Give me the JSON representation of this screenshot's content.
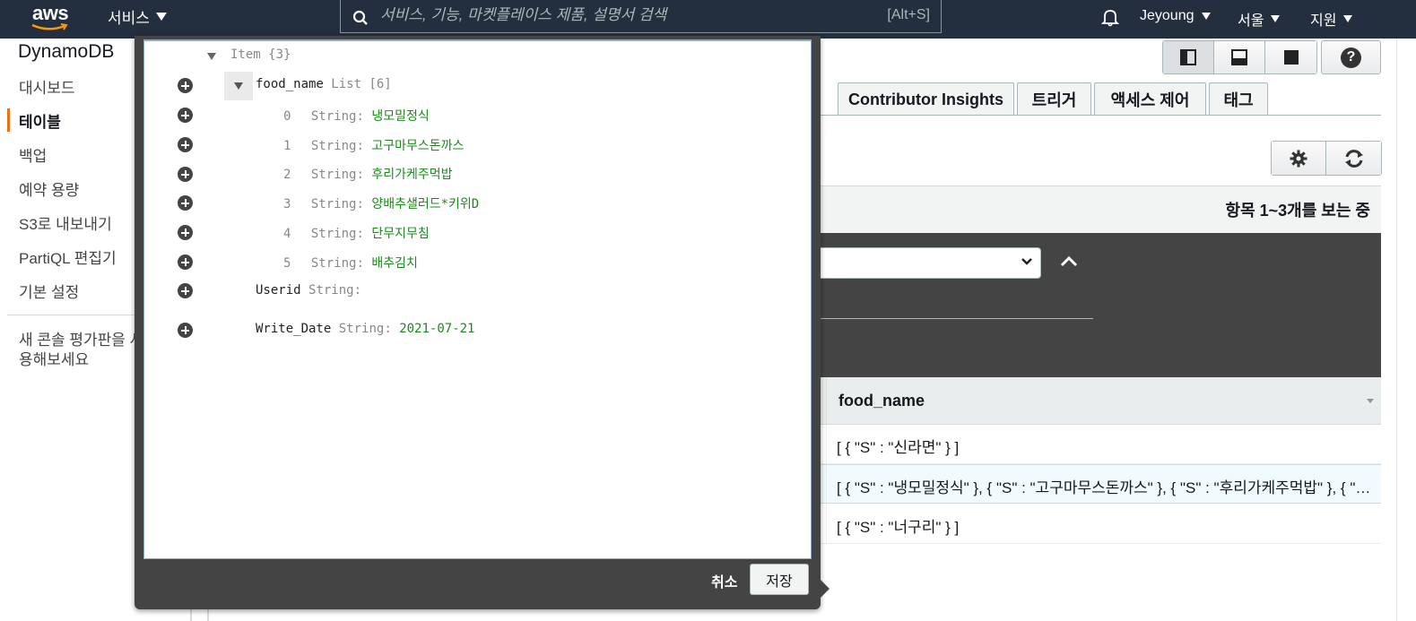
{
  "nav": {
    "logo": "aws",
    "services_label": "서비스",
    "search_placeholder": "서비스, 기능, 마켓플레이스 제품, 설명서 검색",
    "search_shortcut": "[Alt+S]",
    "user": "Jeyoung",
    "region": "서울",
    "support": "지원"
  },
  "sidebar": {
    "brand": "DynamoDB",
    "items": [
      {
        "label": "대시보드"
      },
      {
        "label": "테이블",
        "active": true
      },
      {
        "label": "백업"
      },
      {
        "label": "예약 용량"
      },
      {
        "label": "S3로 내보내기"
      },
      {
        "label": "PartiQL 편집기"
      },
      {
        "label": "기본 설정"
      }
    ],
    "note": "새 콘솔 평가판을 사용해보세요"
  },
  "main": {
    "tabs": [
      {
        "label": "Contributor Insights"
      },
      {
        "label": "트리거"
      },
      {
        "label": "액세스 제어"
      },
      {
        "label": "태그"
      }
    ],
    "items_count": "항목 1~3개를 보는 중",
    "table": {
      "column": "food_name",
      "rows": [
        {
          "value": "[ { \"S\" : \"신라면\" } ]"
        },
        {
          "value": "[ { \"S\" : \"냉모밀정식\" }, { \"S\" : \"고구마무스돈까스\" }, { \"S\" : \"후리가케주먹밥\" }, { \"S\" : \"양배추샐러드*키위D\" } ]",
          "selected": true
        },
        {
          "value": "[ { \"S\" : \"너구리\" } ]"
        }
      ]
    }
  },
  "editor": {
    "root": {
      "key": "Item",
      "type": "{3}"
    },
    "food_name": {
      "key": "food_name",
      "type": "List [6]"
    },
    "list_items": [
      {
        "index": "0",
        "type": "String",
        "value": "냉모밀정식"
      },
      {
        "index": "1",
        "type": "String",
        "value": "고구마무스돈까스"
      },
      {
        "index": "2",
        "type": "String",
        "value": "후리가케주먹밥"
      },
      {
        "index": "3",
        "type": "String",
        "value": "양배추샐러드*키위D"
      },
      {
        "index": "4",
        "type": "String",
        "value": "단무지무침"
      },
      {
        "index": "5",
        "type": "String",
        "value": "배추김치"
      }
    ],
    "userid": {
      "key": "Userid",
      "type": "String",
      "value": ""
    },
    "write_date": {
      "key": "Write_Date",
      "type": "String",
      "value": "2021-07-21"
    },
    "separator": ":"
  },
  "footer": {
    "cancel_label": "취소",
    "save_label": "저장"
  },
  "colors": {
    "nav_bg": "#232f3e",
    "accent": "#ec7211",
    "modal_bg": "#444444",
    "value_green": "#1a8a1a"
  }
}
